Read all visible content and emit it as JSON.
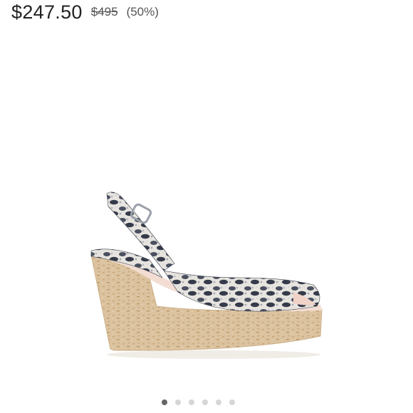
{
  "price": {
    "current": "$247.50",
    "original": "$495",
    "discount": "(50%)"
  },
  "product": {
    "image_icon": "snakeskin-cork-wedge-sandal-image"
  },
  "carousel": {
    "dot_count": 6,
    "active_index": 0
  },
  "colors": {
    "text": "#222222",
    "muted": "#555555",
    "dot_active": "#666666",
    "dot_inactive": "#d6d6d6"
  }
}
